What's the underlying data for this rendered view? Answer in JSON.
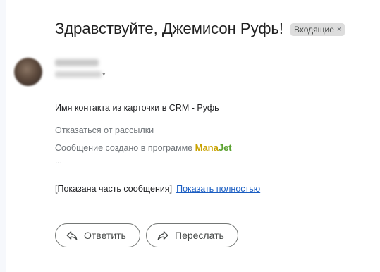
{
  "subject": "Здравствуйте, Джемисон Руфь!",
  "label_chip": {
    "text": "Входящие",
    "remove_glyph": "×"
  },
  "sender": {
    "avatar": "blurred-avatar"
  },
  "body": {
    "line1": "Имя контакта из карточки в CRM -  Руфь",
    "unsubscribe": "Отказаться от рассылки",
    "created_prefix": "Сообщение создано в программе",
    "brand_part1": "Mana",
    "brand_part2": "Jet",
    "ellipsis": "...",
    "trimmed_notice": "[Показана часть сообщения]",
    "show_all_link": "Показать полностью"
  },
  "actions": {
    "reply_label": "Ответить",
    "forward_label": "Переслать"
  },
  "icons": {
    "reply": "reply-icon",
    "forward": "forward-icon"
  },
  "colors": {
    "link": "#1a5dc2",
    "brand_yellow": "#c9a200",
    "brand_green": "#5aa12f",
    "chip_bg": "#dddddd"
  }
}
